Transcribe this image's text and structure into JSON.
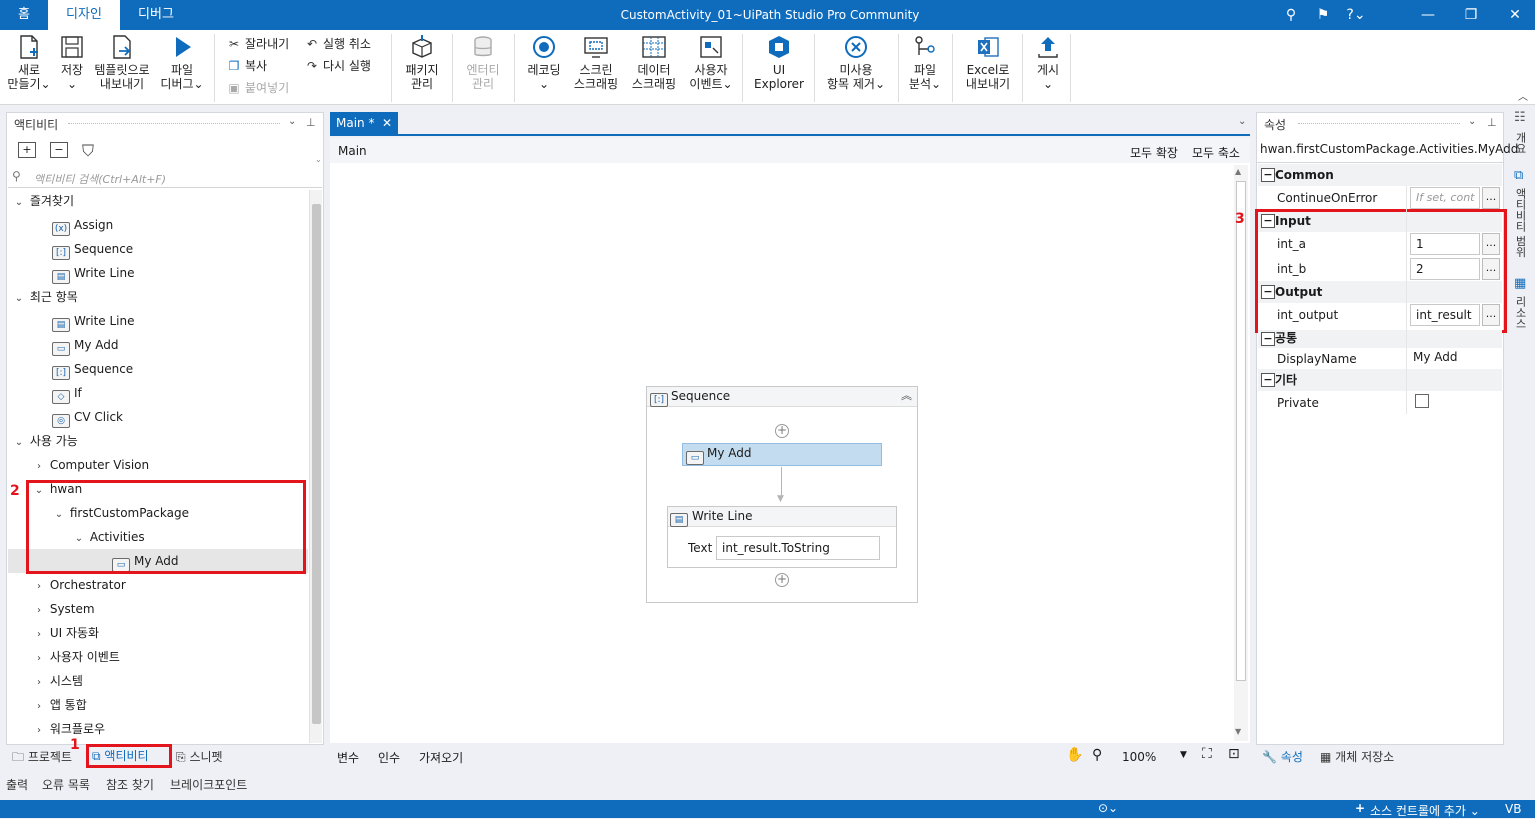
{
  "window": {
    "title": "CustomActivity_01~UiPath Studio Pro Community"
  },
  "tabs": [
    {
      "label": "홈"
    },
    {
      "label": "디자인"
    },
    {
      "label": "디버그"
    }
  ],
  "ribbon": {
    "new": {
      "l1": "새로",
      "l2": "만들기⌄"
    },
    "save": {
      "l1": "저장",
      "l2": "⌄"
    },
    "export_template": {
      "l1": "템플릿으로",
      "l2": "내보내기"
    },
    "debug_file": {
      "l1": "파일",
      "l2": "디버그⌄"
    },
    "cut": "잘라내기",
    "copy": "복사",
    "paste": "붙여넣기",
    "undo": "실행 취소",
    "redo": "다시 실행",
    "manage_packages": {
      "l1": "패키지",
      "l2": "관리"
    },
    "manage_entities": {
      "l1": "엔터티",
      "l2": "관리"
    },
    "recording": {
      "l1": "레코딩",
      "l2": "⌄"
    },
    "screen_scraping": {
      "l1": "스크린",
      "l2": "스크래핑"
    },
    "data_scraping": {
      "l1": "데이터",
      "l2": "스크래핑"
    },
    "user_events": {
      "l1": "사용자",
      "l2": "이벤트⌄"
    },
    "ui_explorer": {
      "l1": "UI",
      "l2": "Explorer"
    },
    "remove_unused": {
      "l1": "미사용",
      "l2": "항목 제거⌄"
    },
    "file_analysis": {
      "l1": "파일",
      "l2": "분석⌄"
    },
    "export_excel": {
      "l1": "Excel로",
      "l2": "내보내기"
    },
    "publish": {
      "l1": "게시",
      "l2": "⌄"
    }
  },
  "activities_panel": {
    "title": "액티비티",
    "search_placeholder": "액티비티 검색(Ctrl+Alt+F)",
    "tree": [
      {
        "label": "즐겨찾기"
      },
      {
        "label": "Assign",
        "icon": "(x)"
      },
      {
        "label": "Sequence",
        "icon": "[:]"
      },
      {
        "label": "Write Line",
        "icon": "▤"
      },
      {
        "label": "최근 항목"
      },
      {
        "label": "Write Line",
        "icon": "▤"
      },
      {
        "label": "My Add",
        "icon": "▭"
      },
      {
        "label": "Sequence",
        "icon": "[:]"
      },
      {
        "label": "If",
        "icon": "◇"
      },
      {
        "label": "CV Click",
        "icon": "◎"
      },
      {
        "label": "사용 가능"
      },
      {
        "label": "Computer Vision"
      },
      {
        "label": "hwan"
      },
      {
        "label": "firstCustomPackage"
      },
      {
        "label": "Activities"
      },
      {
        "label": "My Add",
        "icon": "▭"
      },
      {
        "label": "Orchestrator"
      },
      {
        "label": "System"
      },
      {
        "label": "UI 자동화"
      },
      {
        "label": "사용자 이벤트"
      },
      {
        "label": "시스템"
      },
      {
        "label": "앱 통합"
      },
      {
        "label": "워크플로우"
      }
    ],
    "bottom_tabs": [
      {
        "label": "프로젝트"
      },
      {
        "label": "액티비티"
      },
      {
        "label": "스니펫"
      }
    ],
    "annotations": {
      "one": "1",
      "two": "2"
    }
  },
  "designer": {
    "tab": "Main *",
    "breadcrumb": "Main",
    "expand_all": "모두 확장",
    "collapse_all": "모두 축소",
    "sequence": {
      "title": "Sequence"
    },
    "my_add": {
      "title": "My Add"
    },
    "write_line": {
      "title": "Write Line",
      "text_label": "Text",
      "text_value": "int_result.ToString"
    },
    "bottom": {
      "variables": "변수",
      "arguments": "인수",
      "imports": "가져오기",
      "zoom": "100%"
    }
  },
  "properties": {
    "title": "속성",
    "type_name": "hwan.firstCustomPackage.Activities.MyAdd",
    "annotation": "3",
    "categories": {
      "common": "Common",
      "input": "Input",
      "output": "Output",
      "common_ko": "공통",
      "misc": "기타"
    },
    "rows": {
      "continue_on_error": {
        "name": "ContinueOnError",
        "value": "If set, cont"
      },
      "int_a": {
        "name": "int_a",
        "value": "1"
      },
      "int_b": {
        "name": "int_b",
        "value": "2"
      },
      "int_output": {
        "name": "int_output",
        "value": "int_result"
      },
      "display_name": {
        "name": "DisplayName",
        "value": "My Add"
      },
      "private": {
        "name": "Private"
      }
    },
    "bottom_tabs": [
      {
        "label": "속성"
      },
      {
        "label": "개체 저장소"
      }
    ]
  },
  "side_strip": [
    "개요",
    "액티비티 범위",
    "리소스"
  ],
  "output_tabs": [
    {
      "label": "출력"
    },
    {
      "label": "오류 목록"
    },
    {
      "label": "참조 찾기"
    },
    {
      "label": "브레이크포인트"
    }
  ],
  "status": {
    "source_control": "소스 컨트롤에 추가 ⌄",
    "user": "VB"
  }
}
